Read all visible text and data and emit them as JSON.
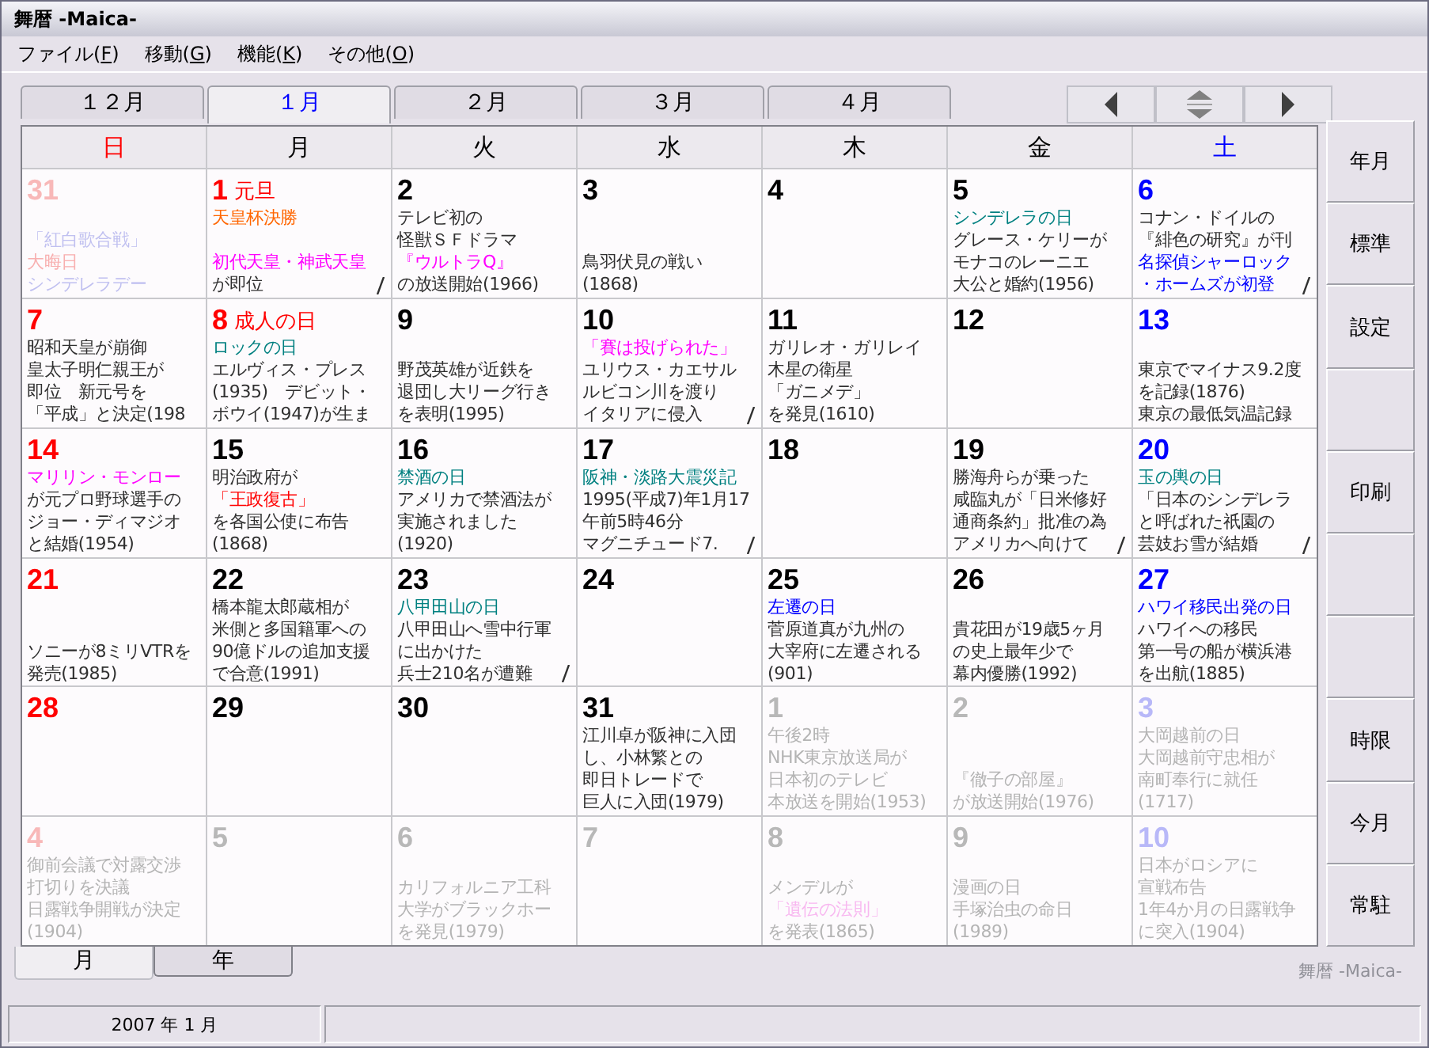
{
  "window": {
    "title": "舞暦 -Maica-"
  },
  "menu": [
    {
      "label": "ファイル(F)"
    },
    {
      "label": "移動(G)"
    },
    {
      "label": "機能(K)"
    },
    {
      "label": "その他(O)"
    }
  ],
  "month_tabs": [
    {
      "label": "１２月",
      "selected": false
    },
    {
      "label": "１月",
      "selected": true
    },
    {
      "label": "２月",
      "selected": false
    },
    {
      "label": "３月",
      "selected": false
    },
    {
      "label": "４月",
      "selected": false
    }
  ],
  "nav_buttons": [
    {
      "kind": "prev"
    },
    {
      "kind": "updown"
    },
    {
      "kind": "next"
    }
  ],
  "weekdays": [
    {
      "label": "日",
      "kind": "sunday"
    },
    {
      "label": "月",
      "kind": "weekday"
    },
    {
      "label": "火",
      "kind": "weekday"
    },
    {
      "label": "水",
      "kind": "weekday"
    },
    {
      "label": "木",
      "kind": "weekday"
    },
    {
      "label": "金",
      "kind": "weekday"
    },
    {
      "label": "土",
      "kind": "saturday"
    }
  ],
  "weeks": [
    [
      {
        "day": "31",
        "dim": true,
        "lines": [
          {
            "kind": "blank"
          },
          {
            "kind": "text",
            "text": "「紅白歌合戦」",
            "color": "#c0c0f0"
          },
          {
            "kind": "text",
            "text": "大晦日",
            "color": "#f8b0b0"
          },
          {
            "kind": "text",
            "text": "シンデレラデー",
            "color": "#c0c0f0"
          }
        ]
      },
      {
        "day": "1",
        "holiday": "元旦",
        "more": true,
        "lines": [
          {
            "kind": "text",
            "text": "天皇杯決勝",
            "color": "#ff6600"
          },
          {
            "kind": "blank"
          },
          {
            "kind": "text",
            "text": "初代天皇・神武天皇",
            "color": "#ff00ff"
          },
          {
            "kind": "text",
            "text": "が即位"
          }
        ]
      },
      {
        "day": "2",
        "lines": [
          {
            "kind": "text",
            "text": "テレビ初の"
          },
          {
            "kind": "text",
            "text": "怪獣ＳＦドラマ"
          },
          {
            "kind": "text",
            "text": "『ウルトラQ』",
            "color": "#ff00ff"
          },
          {
            "kind": "text",
            "text": "の放送開始(1966)"
          }
        ]
      },
      {
        "day": "3",
        "lines": [
          {
            "kind": "blank"
          },
          {
            "kind": "blank"
          },
          {
            "kind": "text",
            "text": "鳥羽伏見の戦い"
          },
          {
            "kind": "text",
            "text": "(1868)"
          }
        ]
      },
      {
        "day": "4"
      },
      {
        "day": "5",
        "lines": [
          {
            "kind": "text",
            "text": "シンデレラの日",
            "color": "#008080"
          },
          {
            "kind": "text",
            "text": "グレース・ケリーが"
          },
          {
            "kind": "text",
            "text": "モナコのレーニエ"
          },
          {
            "kind": "text",
            "text": "大公と婚約(1956)"
          }
        ]
      },
      {
        "day": "6",
        "more": true,
        "lines": [
          {
            "kind": "text",
            "text": "コナン・ドイルの"
          },
          {
            "kind": "text",
            "text": "『緋色の研究』が刊"
          },
          {
            "kind": "text",
            "text": "名探偵シャーロック",
            "color": "#0000ff"
          },
          {
            "kind": "text",
            "text": "・ホームズが初登",
            "color": "#0000ff"
          }
        ]
      }
    ],
    [
      {
        "day": "7",
        "lines": [
          {
            "kind": "text",
            "text": "昭和天皇が崩御"
          },
          {
            "kind": "text",
            "text": "皇太子明仁親王が"
          },
          {
            "kind": "text",
            "text": "即位　新元号を"
          },
          {
            "kind": "text",
            "text": "「平成」と決定(198"
          }
        ]
      },
      {
        "day": "8",
        "holiday": "成人の日",
        "lines": [
          {
            "kind": "text",
            "text": "ロックの日",
            "color": "#008080"
          },
          {
            "kind": "text",
            "text": "エルヴィス・プレス"
          },
          {
            "kind": "text",
            "text": "(1935)　デビット・"
          },
          {
            "kind": "text",
            "text": "ボウイ(1947)が生ま"
          }
        ]
      },
      {
        "day": "9",
        "lines": [
          {
            "kind": "blank"
          },
          {
            "kind": "text",
            "text": "野茂英雄が近鉄を"
          },
          {
            "kind": "text",
            "text": "退団し大リーグ行き"
          },
          {
            "kind": "text",
            "text": "を表明(1995)"
          }
        ]
      },
      {
        "day": "10",
        "more": true,
        "lines": [
          {
            "kind": "text",
            "text": "「賽は投げられた」",
            "color": "#ff00ff"
          },
          {
            "kind": "text",
            "text": "ユリウス・カエサル"
          },
          {
            "kind": "text",
            "text": "ルビコン川を渡り"
          },
          {
            "kind": "text",
            "text": "イタリアに侵入"
          }
        ]
      },
      {
        "day": "11",
        "lines": [
          {
            "kind": "text",
            "text": "ガリレオ・ガリレイ"
          },
          {
            "kind": "text",
            "text": "木星の衛星"
          },
          {
            "kind": "text",
            "text": "「ガニメデ」"
          },
          {
            "kind": "text",
            "text": "を発見(1610)"
          }
        ]
      },
      {
        "day": "12"
      },
      {
        "day": "13",
        "lines": [
          {
            "kind": "blank"
          },
          {
            "kind": "text",
            "text": "東京でマイナス9.2度"
          },
          {
            "kind": "text",
            "text": "を記録(1876)"
          },
          {
            "kind": "text",
            "text": "東京の最低気温記録"
          }
        ]
      }
    ],
    [
      {
        "day": "14",
        "lines": [
          {
            "kind": "text",
            "text": "マリリン・モンロー",
            "color": "#ff00ff"
          },
          {
            "kind": "text",
            "text": "が元プロ野球選手の"
          },
          {
            "kind": "text",
            "text": "ジョー・ディマジオ"
          },
          {
            "kind": "text",
            "text": "と結婚(1954)"
          }
        ]
      },
      {
        "day": "15",
        "lines": [
          {
            "kind": "text",
            "text": "明治政府が"
          },
          {
            "kind": "text",
            "text": "「王政復古」",
            "color": "#ff0000"
          },
          {
            "kind": "text",
            "text": "を各国公使に布告"
          },
          {
            "kind": "text",
            "text": "(1868)"
          }
        ]
      },
      {
        "day": "16",
        "lines": [
          {
            "kind": "text",
            "text": "禁酒の日",
            "color": "#008080"
          },
          {
            "kind": "text",
            "text": "アメリカで禁酒法が"
          },
          {
            "kind": "text",
            "text": "実施されました"
          },
          {
            "kind": "text",
            "text": "(1920)"
          }
        ]
      },
      {
        "day": "17",
        "more": true,
        "lines": [
          {
            "kind": "text",
            "text": "阪神・淡路大震災記",
            "color": "#008080"
          },
          {
            "kind": "text",
            "text": "1995(平成7)年1月17"
          },
          {
            "kind": "text",
            "text": "午前5時46分"
          },
          {
            "kind": "text",
            "text": "マグニチュード7."
          }
        ]
      },
      {
        "day": "18"
      },
      {
        "day": "19",
        "more": true,
        "lines": [
          {
            "kind": "text",
            "text": "勝海舟らが乗った"
          },
          {
            "kind": "text",
            "text": "咸臨丸が「日米修好"
          },
          {
            "kind": "text",
            "text": "通商条約」批准の為"
          },
          {
            "kind": "text",
            "text": "アメリカへ向けて"
          }
        ]
      },
      {
        "day": "20",
        "more": true,
        "lines": [
          {
            "kind": "text",
            "text": "玉の輿の日",
            "color": "#008080"
          },
          {
            "kind": "text",
            "text": "「日本のシンデレラ"
          },
          {
            "kind": "text",
            "text": "と呼ばれた祇園の"
          },
          {
            "kind": "text",
            "text": "芸妓お雪が結婚"
          }
        ]
      }
    ],
    [
      {
        "day": "21",
        "lines": [
          {
            "kind": "blank"
          },
          {
            "kind": "blank"
          },
          {
            "kind": "text",
            "text": "ソニーが8ミリVTRを"
          },
          {
            "kind": "text",
            "text": "発売(1985)"
          }
        ]
      },
      {
        "day": "22",
        "lines": [
          {
            "kind": "text",
            "text": "橋本龍太郎蔵相が"
          },
          {
            "kind": "text",
            "text": "米側と多国籍軍への"
          },
          {
            "kind": "text",
            "text": "90億ドルの追加支援"
          },
          {
            "kind": "text",
            "text": "で合意(1991)"
          }
        ]
      },
      {
        "day": "23",
        "more": true,
        "lines": [
          {
            "kind": "text",
            "text": "八甲田山の日",
            "color": "#008080"
          },
          {
            "kind": "text",
            "text": "八甲田山へ雪中行軍"
          },
          {
            "kind": "text",
            "text": "に出かけた"
          },
          {
            "kind": "text",
            "text": "兵士210名が遭難"
          }
        ]
      },
      {
        "day": "24"
      },
      {
        "day": "25",
        "lines": [
          {
            "kind": "text",
            "text": "左遷の日",
            "color": "#0000ff"
          },
          {
            "kind": "text",
            "text": "菅原道真が九州の"
          },
          {
            "kind": "text",
            "text": "大宰府に左遷される"
          },
          {
            "kind": "text",
            "text": "(901)"
          }
        ]
      },
      {
        "day": "26",
        "lines": [
          {
            "kind": "blank"
          },
          {
            "kind": "text",
            "text": "貴花田が19歳5ヶ月"
          },
          {
            "kind": "text",
            "text": "の史上最年少で"
          },
          {
            "kind": "text",
            "text": "幕内優勝(1992)"
          }
        ]
      },
      {
        "day": "27",
        "lines": [
          {
            "kind": "text",
            "text": "ハワイ移民出発の日",
            "color": "#0000ff"
          },
          {
            "kind": "text",
            "text": "ハワイへの移民"
          },
          {
            "kind": "text",
            "text": "第一号の船が横浜港"
          },
          {
            "kind": "text",
            "text": "を出航(1885)"
          }
        ]
      }
    ],
    [
      {
        "day": "28"
      },
      {
        "day": "29"
      },
      {
        "day": "30"
      },
      {
        "day": "31",
        "lines": [
          {
            "kind": "text",
            "text": "江川卓が阪神に入団"
          },
          {
            "kind": "text",
            "text": "し、小林繁との"
          },
          {
            "kind": "text",
            "text": "即日トレードで"
          },
          {
            "kind": "text",
            "text": "巨人に入団(1979)"
          }
        ]
      },
      {
        "day": "1",
        "dim": true,
        "lines": [
          {
            "kind": "text",
            "text": "午後2時"
          },
          {
            "kind": "text",
            "text": "NHK東京放送局が"
          },
          {
            "kind": "text",
            "text": "日本初のテレビ"
          },
          {
            "kind": "text",
            "text": "本放送を開始(1953)"
          }
        ]
      },
      {
        "day": "2",
        "dim": true,
        "lines": [
          {
            "kind": "blank"
          },
          {
            "kind": "blank"
          },
          {
            "kind": "text",
            "text": "『徹子の部屋』"
          },
          {
            "kind": "text",
            "text": "が放送開始(1976)"
          }
        ]
      },
      {
        "day": "3",
        "dim": true,
        "lines": [
          {
            "kind": "text",
            "text": "大岡越前の日"
          },
          {
            "kind": "text",
            "text": "大岡越前守忠相が"
          },
          {
            "kind": "text",
            "text": "南町奉行に就任"
          },
          {
            "kind": "text",
            "text": "(1717)"
          }
        ]
      }
    ],
    [
      {
        "day": "4",
        "dim": true,
        "lines": [
          {
            "kind": "text",
            "text": "御前会議で対露交渉"
          },
          {
            "kind": "text",
            "text": "打切りを決議"
          },
          {
            "kind": "text",
            "text": "日露戦争開戦が決定"
          },
          {
            "kind": "text",
            "text": "(1904)"
          }
        ]
      },
      {
        "day": "5",
        "dim": true
      },
      {
        "day": "6",
        "dim": true,
        "lines": [
          {
            "kind": "blank"
          },
          {
            "kind": "text",
            "text": "カリフォルニア工科"
          },
          {
            "kind": "text",
            "text": "大学がブラックホー"
          },
          {
            "kind": "text",
            "text": "を発見(1979)"
          }
        ]
      },
      {
        "day": "7",
        "dim": true
      },
      {
        "day": "8",
        "dim": true,
        "lines": [
          {
            "kind": "blank"
          },
          {
            "kind": "text",
            "text": "メンデルが"
          },
          {
            "kind": "text",
            "text": "「遺伝の法則」",
            "color": "#f8b8f0"
          },
          {
            "kind": "text",
            "text": "を発表(1865)"
          }
        ]
      },
      {
        "day": "9",
        "dim": true,
        "lines": [
          {
            "kind": "blank"
          },
          {
            "kind": "text",
            "text": "漫画の日"
          },
          {
            "kind": "text",
            "text": "手塚治虫の命日"
          },
          {
            "kind": "text",
            "text": "(1989)"
          }
        ]
      },
      {
        "day": "10",
        "dim": true,
        "lines": [
          {
            "kind": "text",
            "text": "日本がロシアに"
          },
          {
            "kind": "text",
            "text": "宣戦布告"
          },
          {
            "kind": "text",
            "text": "1年4か月の日露戦争"
          },
          {
            "kind": "text",
            "text": "に突入(1904)"
          }
        ]
      }
    ]
  ],
  "side_buttons": [
    {
      "kind": "label",
      "label": "年月"
    },
    {
      "kind": "label",
      "label": "標準"
    },
    {
      "kind": "label",
      "label": "設定"
    },
    {
      "kind": "blank"
    },
    {
      "kind": "label",
      "label": "印刷"
    },
    {
      "kind": "blank"
    },
    {
      "kind": "blank"
    },
    {
      "kind": "label",
      "label": "時限"
    },
    {
      "kind": "label",
      "label": "今月"
    },
    {
      "kind": "label",
      "label": "常駐"
    }
  ],
  "view_tabs": [
    {
      "label": "月",
      "selected": true
    },
    {
      "label": "年",
      "selected": false
    }
  ],
  "brand": "舞暦 -Maica-",
  "status_bar": {
    "date": "2007 年 1 月"
  }
}
